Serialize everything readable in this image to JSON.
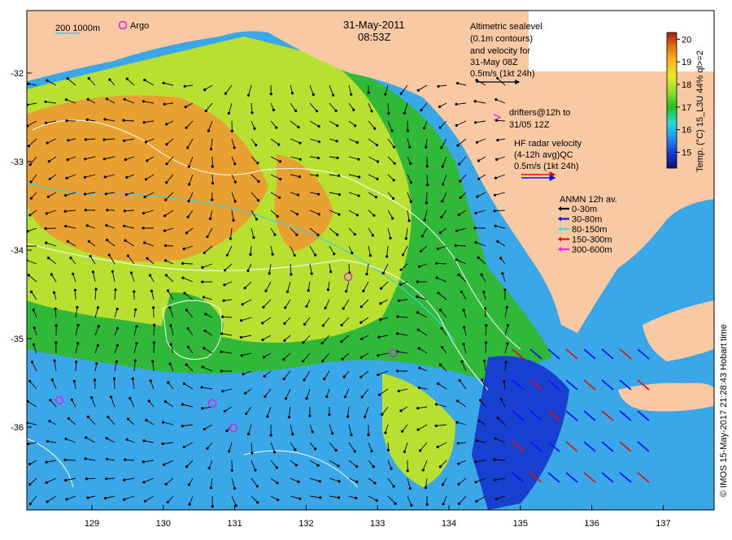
{
  "header": {
    "date": "31-May-2011",
    "time": "08:53Z",
    "depth_legend": "200  1000m",
    "argo_label": "Argo"
  },
  "altimetry_note": {
    "line1": "Altimetric sealevel",
    "line2": "(0.1m contours)",
    "line3": "and velocity for",
    "line4": "31-May 08Z",
    "line5": "0.5m/s (1kt 24h)"
  },
  "drifters_note": {
    "symbol": ">",
    "line1": "drifters@12h to",
    "line2": "31/05 12Z"
  },
  "hf_radar_note": {
    "line1": "HF radar velocity",
    "line2": "(4-12h avg)QC",
    "line3": "0.5m/s (1kt 24h)"
  },
  "anmn_legend": {
    "title": "ANMN 12h av.",
    "items": [
      {
        "label": "0-30m",
        "color": "#000000"
      },
      {
        "label": "30-80m",
        "color": "#1010ff"
      },
      {
        "label": "80-150m",
        "color": "#40e0e0"
      },
      {
        "label": "150-300m",
        "color": "#e01010"
      },
      {
        "label": "300-600m",
        "color": "#ff20ff"
      }
    ]
  },
  "colorbar": {
    "title": "Temp. (°C) 15_L3U 44% ql>=2",
    "ticks": [
      "20",
      "19",
      "18",
      "17",
      "16",
      "15"
    ],
    "range": [
      14.3,
      20.3
    ],
    "colors": [
      "#0a0f7a",
      "#1840d0",
      "#20a0ff",
      "#20e0d0",
      "#20c020",
      "#90e030",
      "#e8e820",
      "#ffb020",
      "#e07010",
      "#a02010"
    ]
  },
  "axes": {
    "x_ticks": [
      "129",
      "130",
      "131",
      "132",
      "133",
      "134",
      "135",
      "136",
      "137"
    ],
    "y_ticks": [
      "-32",
      "-33",
      "-34",
      "-35",
      "-36"
    ]
  },
  "credit": "© IMOS 15-May-2017 21:28:43 Hobart time",
  "colors": {
    "land": "#f9c9a3",
    "warm": "#e8a030",
    "mid": "#b8e030",
    "green": "#30b838",
    "cool": "#3aa8e8",
    "contour": "#ffffff",
    "isobath": "#40d0e0",
    "argo": "#e020e0"
  }
}
